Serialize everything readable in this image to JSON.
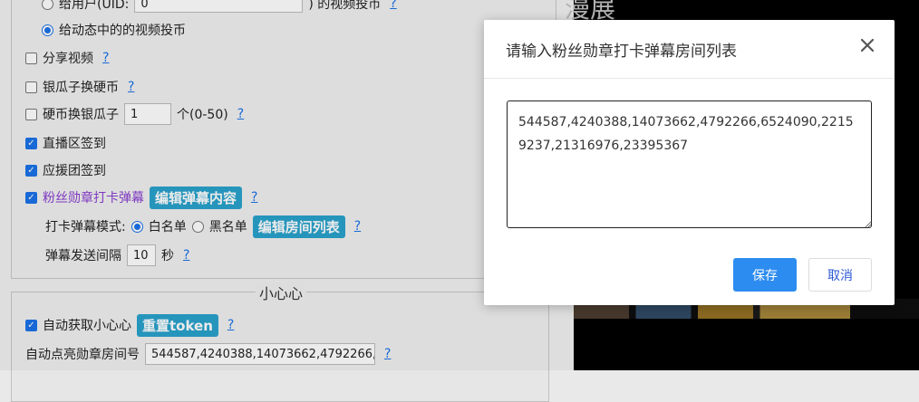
{
  "background": {
    "right_title": "漫展",
    "top_row": {
      "prefix": "给用户(UID:",
      "uid_value": "0",
      "suffix": ") 的视频投币",
      "help": "?"
    },
    "rows": [
      {
        "label": "给动态中的的视频投币"
      },
      {
        "label": "分享视频",
        "help": "?"
      },
      {
        "label": "银瓜子换硬币",
        "help": "?"
      },
      {
        "label": "硬币换银瓜子",
        "input": "1",
        "unit": "个(0-50)",
        "help": "?"
      },
      {
        "label": "直播区签到"
      },
      {
        "label": "应援团签到"
      },
      {
        "label": "粉丝勋章打卡弹幕",
        "button": "编辑弹幕内容",
        "help": "?"
      },
      {
        "label": "打卡弹幕模式:",
        "radio1": "白名单",
        "radio2": "黑名单",
        "button": "编辑房间列表",
        "help": "?"
      },
      {
        "label": "弹幕发送间隔",
        "input": "10",
        "unit": "秒",
        "help": "?"
      }
    ],
    "section2": {
      "legend": "小心心",
      "auto_label": "自动获取小心心",
      "reset_button": "重置token",
      "help": "?",
      "room_label": "自动点亮勋章房间号",
      "room_value": "544587,4240388,14073662,4792266,",
      "room_help": "?"
    }
  },
  "dialog": {
    "title": "请输入粉丝勋章打卡弹幕房间列表",
    "textarea_value": "544587,4240388,14073662,4792266,6524090,22159237,21316976,23395367",
    "save_label": "保存",
    "cancel_label": "取消"
  },
  "colors": {
    "primary": "#2d8cf0",
    "teal_button": "#2aa3cc",
    "checkbox": "#1a73e8",
    "purple_label": "#8a3fd1"
  }
}
